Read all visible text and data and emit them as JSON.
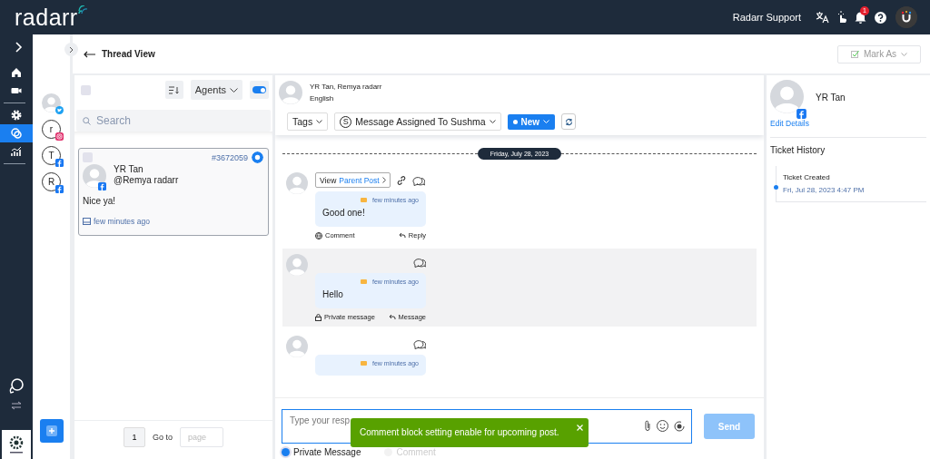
{
  "header": {
    "logo": "radarr",
    "user": "Radarr Support",
    "notification_count": "1"
  },
  "rail": {
    "items": [
      {
        "kind": "home",
        "selected": false
      },
      {
        "kind": "video",
        "selected": false
      },
      {
        "kind": "settings",
        "selected": false
      },
      {
        "kind": "chat",
        "selected": true
      },
      {
        "kind": "analytics",
        "selected": false
      }
    ]
  },
  "accounts": [
    {
      "kind": "photo",
      "badge": {
        "kind": "twitter"
      }
    },
    {
      "kind": "letter",
      "letter": "r",
      "badge": {
        "kind": "instagram"
      }
    },
    {
      "kind": "letter",
      "letter": "T",
      "badge": {
        "kind": "facebook"
      }
    },
    {
      "kind": "letter",
      "letter": "R",
      "badge": {
        "kind": "facebook"
      }
    }
  ],
  "page_title": "Thread View",
  "mark_as": "Mark As",
  "ticket_list": {
    "select_all_checked": false,
    "agents": "Agents",
    "toggle_on": true,
    "search_placeholder": "Search",
    "tickets": [
      {
        "id": "#3672059",
        "name": "YR Tan",
        "handle": "@Remya radarr",
        "text": "Nice ya!",
        "time": "few minutes ago",
        "checked": false,
        "selected": true
      }
    ],
    "pagination": {
      "page": "1",
      "goto": "Go to",
      "placeholder": "page"
    }
  },
  "thread": {
    "participants": "YR Tan, Remya radarr",
    "language": "English",
    "tags": "Tags",
    "assignee_initial": "S",
    "assignment": "Message Assigned To Sushma",
    "status": "New",
    "date": "Friday, July 28, 2023",
    "messages": [
      {
        "highlighted": false,
        "parent_post": {
          "prefix": "View",
          "link": "Parent Post"
        },
        "time": "few minutes ago",
        "text": "Good one!",
        "actions": [
          {
            "kind": "comment",
            "label": "Comment"
          },
          {
            "kind": "reply",
            "label": "Reply"
          }
        ]
      },
      {
        "highlighted": true,
        "time": "few minutes ago",
        "text": "Hello",
        "actions": [
          {
            "kind": "private",
            "label": "Private message"
          },
          {
            "kind": "reply",
            "label": "Message"
          }
        ]
      },
      {
        "highlighted": false,
        "time": "few minutes ago"
      }
    ]
  },
  "composer": {
    "placeholder": "Type your resp",
    "send": "Send",
    "send_disabled": true,
    "modes": [
      {
        "label": "Private Message",
        "selected": true,
        "disabled": false
      },
      {
        "label": "Comment",
        "selected": false,
        "disabled": true
      }
    ]
  },
  "toast": {
    "message": "Comment block setting enable for upcoming post."
  },
  "profile": {
    "name": "YR Tan",
    "edit": "Edit Details",
    "history_title": "Ticket History",
    "history": [
      {
        "event": "Ticket Created",
        "time": "Fri, Jul 28, 2023 4:47 PM"
      }
    ]
  }
}
